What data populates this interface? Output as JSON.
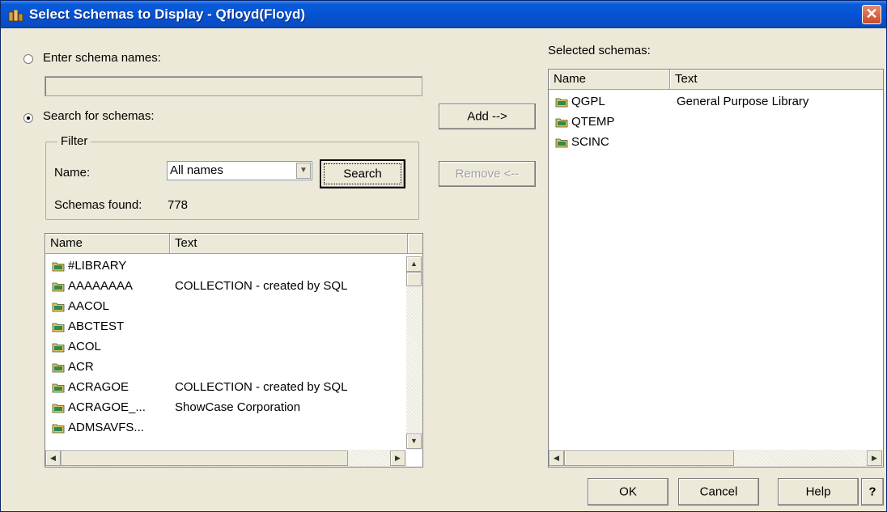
{
  "window": {
    "title": "Select Schemas to Display - Qfloyd(Floyd)",
    "close_label": "✕"
  },
  "enter_names": {
    "label": "Enter schema names:",
    "value": ""
  },
  "search": {
    "label": "Search for schemas:"
  },
  "filter": {
    "legend": "Filter",
    "name_label": "Name:",
    "name_value": "All names",
    "search_button": "Search",
    "found_label": "Schemas found:",
    "found_count": "778"
  },
  "left_list": {
    "columns": [
      "Name",
      "Text"
    ],
    "rows": [
      {
        "name": "#LIBRARY",
        "text": ""
      },
      {
        "name": "AAAAAAAA",
        "text": "COLLECTION - created by SQL"
      },
      {
        "name": "AACOL",
        "text": ""
      },
      {
        "name": "ABCTEST",
        "text": ""
      },
      {
        "name": "ACOL",
        "text": ""
      },
      {
        "name": "ACR",
        "text": ""
      },
      {
        "name": "ACRAGOE",
        "text": "COLLECTION - created by SQL"
      },
      {
        "name": "ACRAGOE_...",
        "text": "ShowCase Corporation"
      },
      {
        "name": "ADMSAVFS...",
        "text": ""
      }
    ]
  },
  "middle": {
    "add_button": "Add -->",
    "remove_button": "Remove <--"
  },
  "selected": {
    "label": "Selected schemas:",
    "columns": [
      "Name",
      "Text"
    ],
    "rows": [
      {
        "name": "QGPL",
        "text": "General Purpose Library"
      },
      {
        "name": "QTEMP",
        "text": ""
      },
      {
        "name": "SCINC",
        "text": ""
      }
    ]
  },
  "footer": {
    "ok": "OK",
    "cancel": "Cancel",
    "help": "Help",
    "question": "?"
  },
  "icons": {
    "title": "schemas-app-icon",
    "folder": "folder-icon"
  }
}
